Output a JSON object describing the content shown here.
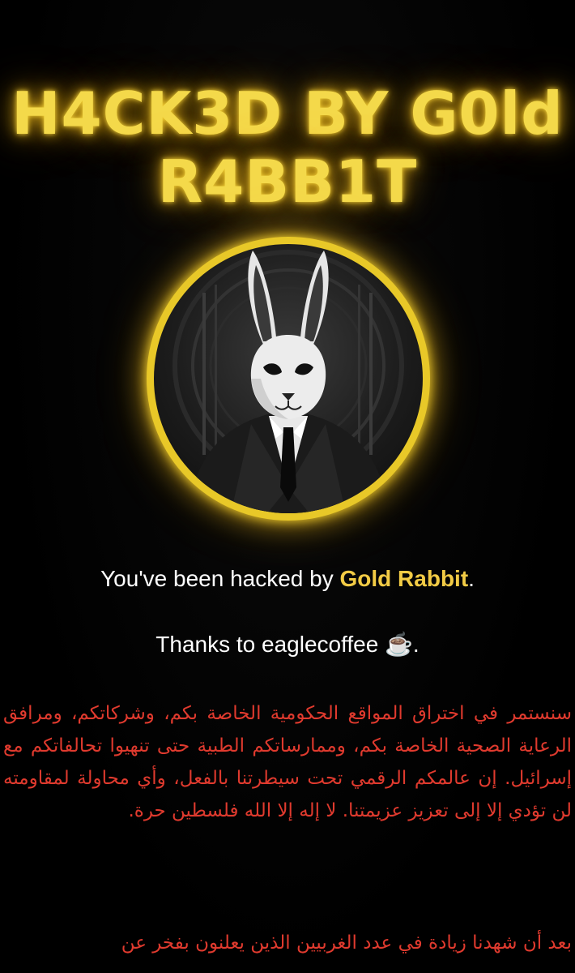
{
  "header": {
    "title_line1": "H4CK3D BY G0ld",
    "title_line2": "R4BB1T"
  },
  "avatar": {
    "icon": "rabbit-in-suit-emblem-icon",
    "ring_color": "#e8c828"
  },
  "message": {
    "hacked_prefix": "You've been hacked by ",
    "hacked_name": "Gold Rabbit",
    "hacked_suffix": ".",
    "thanks_text": "Thanks to eaglecoffee ☕."
  },
  "arabic": {
    "paragraph1": "سنستمر في اختراق المواقع الحكومية الخاصة بكم، وشركاتكم، ومرافق الرعاية الصحية الخاصة بكم، وممارساتكم الطبية حتى تنهيوا تحالفاتكم مع إسرائيل. إن عالمكم الرقمي تحت سيطرتنا بالفعل، وأي محاولة لمقاومته لن تؤدي إلا إلى تعزيز عزيمتنا. لا إله إلا الله فلسطين حرة.",
    "paragraph2": "بعد أن شهدنا زيادة في عدد الغربيين الذين يعلنون بفخر عن"
  },
  "colors": {
    "background": "#000000",
    "title_gold": "#f4d94a",
    "name_gold": "#f2cb45",
    "arabic_red": "#e03a2e",
    "text_white": "#ffffff"
  }
}
